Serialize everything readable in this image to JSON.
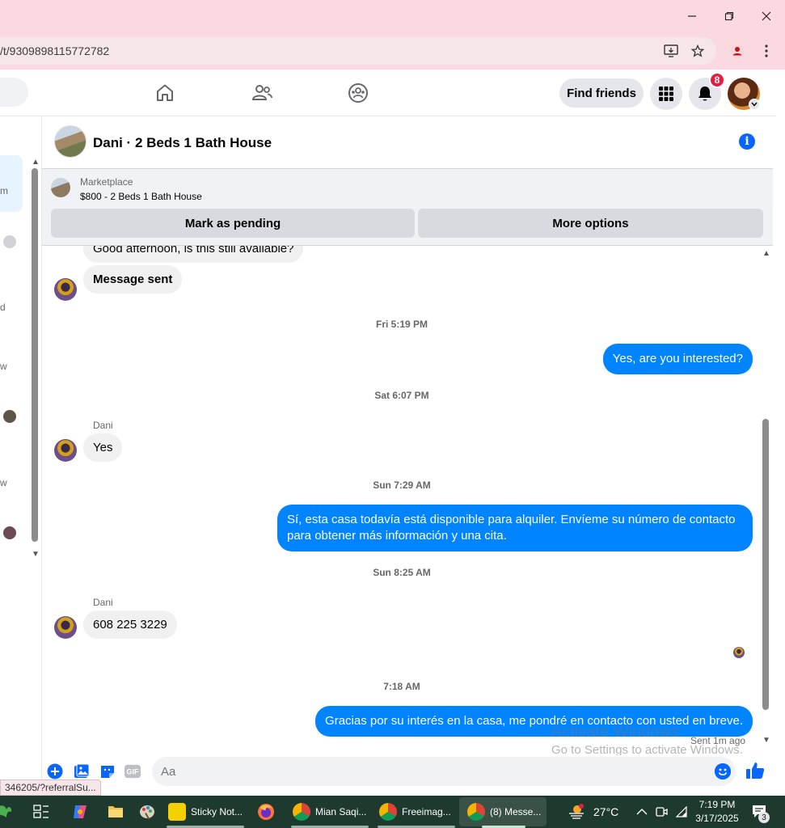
{
  "browser": {
    "url": "/t/9309898115772782",
    "status_url": "346205/?referralSu..."
  },
  "fb_nav": {
    "find_friends_label": "Find friends",
    "notifications_count": "8"
  },
  "conversation": {
    "title": "Dani · 2 Beds 1 Bath House"
  },
  "marketplace": {
    "label": "Marketplace",
    "item": "$800 - 2 Beds 1 Bath House",
    "mark_pending_label": "Mark as pending",
    "more_options_label": "More options"
  },
  "sidebar_fragments": [
    "m",
    "d",
    "w",
    "w"
  ],
  "messages": [
    {
      "type": "in",
      "text": "Good afternoon, is this still available?"
    },
    {
      "type": "in",
      "text": "Message sent"
    },
    {
      "type": "timestamp",
      "text": "Fri 5:19 PM"
    },
    {
      "type": "out",
      "text": "Yes, are you interested?"
    },
    {
      "type": "timestamp",
      "text": "Sat 6:07 PM"
    },
    {
      "type": "sender",
      "text": "Dani"
    },
    {
      "type": "in",
      "text": "Yes"
    },
    {
      "type": "timestamp",
      "text": "Sun 7:29 AM"
    },
    {
      "type": "out",
      "text": "Sí, esta casa todavía está disponible para alquiler. Envíeme su número de contacto para obtener más información y una cita."
    },
    {
      "type": "timestamp",
      "text": "Sun 8:25 AM"
    },
    {
      "type": "sender",
      "text": "Dani"
    },
    {
      "type": "in",
      "text": "608 225 3229"
    },
    {
      "type": "timestamp",
      "text": "7:18 AM"
    },
    {
      "type": "out",
      "text": "Gracias por su interés en la casa, me pondré en contacto con usted en breve."
    }
  ],
  "sent_status": "Sent 1m ago",
  "watermark": {
    "title": "Activate Windows",
    "subtitle": "Go to Settings to activate Windows."
  },
  "composer": {
    "placeholder": "Aa"
  },
  "taskbar": {
    "items": [
      {
        "label": "Sticky Not...",
        "color": "#f5d000"
      },
      {
        "label": "Mian Saqi...",
        "color": "#db4437"
      },
      {
        "label": "Freeimag...",
        "color": "#4285f4"
      },
      {
        "label": "(8) Messe...",
        "color": "#db4437"
      }
    ],
    "weather": "27°C",
    "time": "7:19 PM",
    "date": "3/17/2025",
    "notification_count": "3"
  },
  "colors": {
    "messenger_blue": "#0084ff",
    "fb_blue": "#0866ff",
    "badge_red": "#e41e3f",
    "chrome_titlebar": "#fbd9e0"
  },
  "icons": [
    "home-icon",
    "friends-icon",
    "groups-icon",
    "apps-grid-icon",
    "bell-icon",
    "info-icon",
    "plus-icon",
    "photo-icon",
    "sticker-icon",
    "gif-icon",
    "emoji-icon",
    "thumbs-up-icon",
    "minimize-icon",
    "maximize-icon",
    "close-icon",
    "install-icon",
    "star-icon",
    "profile-icon",
    "kebab-menu-icon"
  ]
}
